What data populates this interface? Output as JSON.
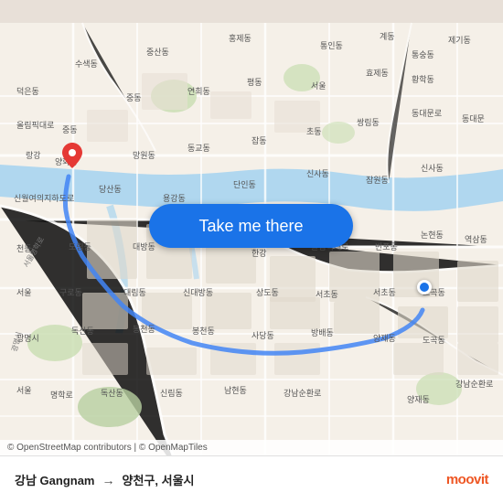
{
  "map": {
    "background_color": "#e8e0d8",
    "attribution": "© OpenStreetMap contributors | © OpenMapTiles"
  },
  "button": {
    "label": "Take me there"
  },
  "route": {
    "from": "강남 Gangnam",
    "arrow": "→",
    "to": "양천구, 서울시"
  },
  "branding": {
    "logo": "moovit"
  },
  "icons": {
    "origin_marker": "red-pin-icon",
    "destination_marker": "blue-dot-icon"
  }
}
